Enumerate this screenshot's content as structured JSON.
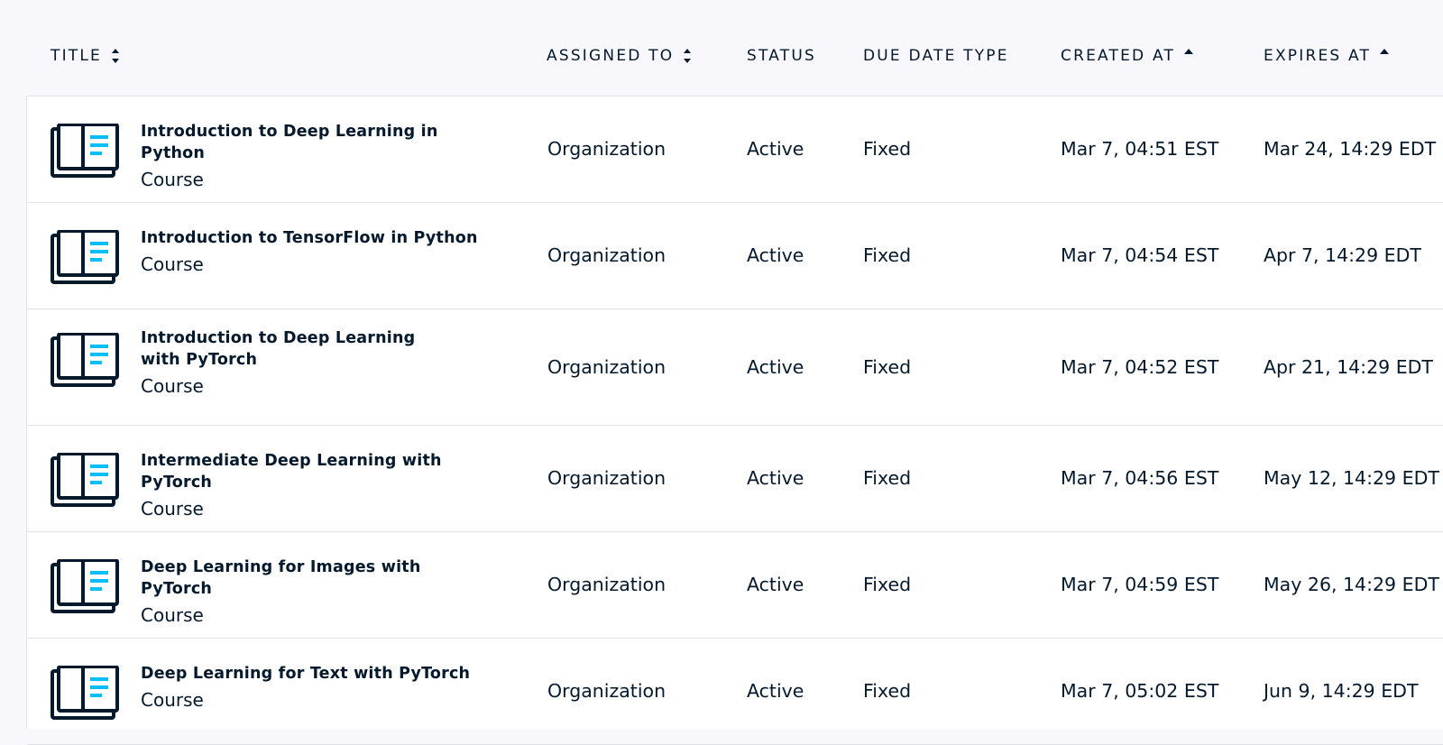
{
  "columns": {
    "title": "TITLE",
    "assigned_to": "ASSIGNED TO",
    "status": "STATUS",
    "due_date_type": "DUE DATE TYPE",
    "created_at": "CREATED AT",
    "expires_at": "EXPIRES AT"
  },
  "sort_indicators": {
    "title": "sort-both",
    "assigned_to": "sort-both",
    "created_at": "sort-ascending",
    "expires_at": "sort-ascending"
  },
  "colors": {
    "background": "#f7f7fc",
    "text": "#05192d",
    "icon_accent": "#03ef62",
    "icon_lines": "#06bdfc",
    "row_border": "#e1e1e8"
  },
  "rows": [
    {
      "icon": "course-book-icon",
      "title": "Introduction to Deep Learning in Python",
      "type": "Course",
      "assigned_to": "Organization",
      "status": "Active",
      "due_date_type": "Fixed",
      "created_at": "Mar 7, 04:51 EST",
      "expires_at": "Mar 24, 14:29 EDT"
    },
    {
      "icon": "course-book-icon",
      "title": "Introduction to TensorFlow in Python",
      "type": "Course",
      "assigned_to": "Organization",
      "status": "Active",
      "due_date_type": "Fixed",
      "created_at": "Mar 7, 04:54 EST",
      "expires_at": "Apr 7, 14:29 EDT"
    },
    {
      "icon": "course-book-icon",
      "title": "Introduction to Deep Learning with PyTorch",
      "type": "Course",
      "assigned_to": "Organization",
      "status": "Active",
      "due_date_type": "Fixed",
      "created_at": "Mar 7, 04:52 EST",
      "expires_at": "Apr 21, 14:29 EDT"
    },
    {
      "icon": "course-book-icon",
      "title": "Intermediate Deep Learning with PyTorch",
      "type": "Course",
      "assigned_to": "Organization",
      "status": "Active",
      "due_date_type": "Fixed",
      "created_at": "Mar 7, 04:56 EST",
      "expires_at": "May 12, 14:29 EDT"
    },
    {
      "icon": "course-book-icon",
      "title": "Deep Learning for Images with PyTorch",
      "type": "Course",
      "assigned_to": "Organization",
      "status": "Active",
      "due_date_type": "Fixed",
      "created_at": "Mar 7, 04:59 EST",
      "expires_at": "May 26, 14:29 EDT"
    },
    {
      "icon": "course-book-icon",
      "title": "Deep Learning for Text with PyTorch",
      "type": "Course",
      "assigned_to": "Organization",
      "status": "Active",
      "due_date_type": "Fixed",
      "created_at": "Mar 7, 05:02 EST",
      "expires_at": "Jun 9, 14:29 EDT"
    }
  ]
}
